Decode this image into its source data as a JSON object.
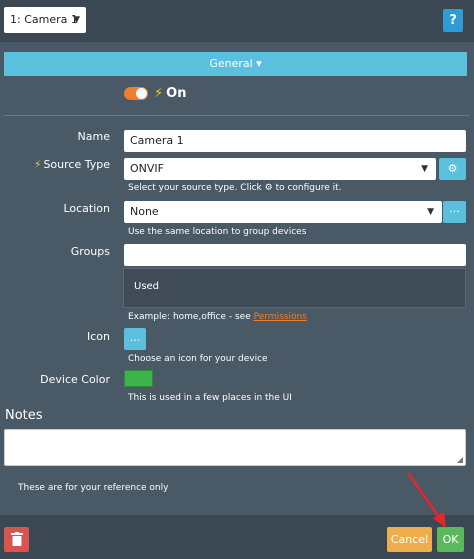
{
  "header": {
    "camera_select_value": "1: Camera 1",
    "help_label": "?"
  },
  "section": {
    "general_label": "General ▾"
  },
  "enabled": {
    "state_label": "On"
  },
  "form": {
    "name": {
      "label": "Name",
      "value": "Camera 1"
    },
    "source_type": {
      "label": "Source Type",
      "value": "ONVIF",
      "help_before": "Select your source type. Click",
      "help_after": "to configure it."
    },
    "location": {
      "label": "Location",
      "value": "None",
      "button_label": "···",
      "help": "Use the same location to group devices"
    },
    "groups": {
      "label": "Groups",
      "value": "",
      "used_label": "Used",
      "help_prefix": "Example: home,office - see",
      "help_link": "Permissions"
    },
    "icon": {
      "label": "Icon",
      "button_label": "...",
      "help": "Choose an icon for your device"
    },
    "device_color": {
      "label": "Device Color",
      "color": "#3cb44b",
      "help": "This is used in a few places in the UI"
    }
  },
  "notes": {
    "title": "Notes",
    "value": "",
    "help": "These are for your reference only"
  },
  "footer": {
    "cancel_label": "Cancel",
    "ok_label": "OK"
  },
  "colors": {
    "accent": "#5bc0de",
    "toggle": "#f07c2e",
    "danger": "#d9534f",
    "warning": "#f0ad4e",
    "success": "#5cb85c",
    "annotation_arrow": "#e8262a"
  }
}
